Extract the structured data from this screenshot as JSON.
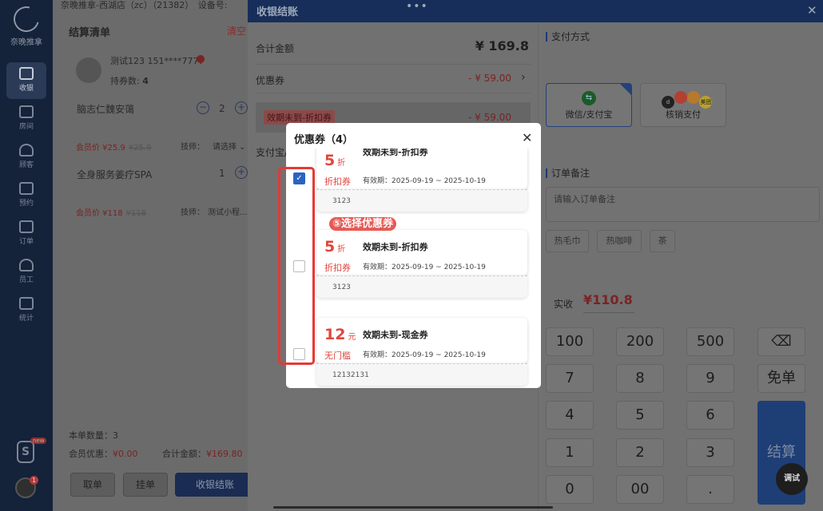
{
  "nav": {
    "brand": "奈晚推拿",
    "items": [
      {
        "label": "收银",
        "active": true
      },
      {
        "label": "房间"
      },
      {
        "label": "顾客"
      },
      {
        "label": "预约"
      },
      {
        "label": "订单"
      },
      {
        "label": "员工"
      },
      {
        "label": "统计"
      }
    ],
    "s_logo": "S",
    "new_badge": "new",
    "avatar_badge": "1"
  },
  "settlement": {
    "store_title": "奈晚推拿-西湖店（zc）（21382）　设备号:",
    "list_title": "结算清单",
    "clear_label": "清空",
    "member_name": "测试123 151****7777",
    "coupon_count_label": "持券数:",
    "coupon_count": "4",
    "items": [
      {
        "name": "脑志仁魏安蔼",
        "qty": "2",
        "member_price": "会员价 ¥25.9",
        "orig_price": "¥25.9",
        "tech_label": "技师：",
        "tech_value": "请选择 ⌄"
      },
      {
        "name": "全身服务姜疗SPA",
        "qty": "1",
        "member_price": "会员价 ¥118",
        "orig_price": "¥118",
        "tech_label": "技师：",
        "tech_value": "测试小程... ⌄"
      }
    ],
    "count_label": "本单数量：3",
    "member_discount_label": "会员优惠：",
    "member_discount": "¥0.00",
    "total_label": "合计金额：",
    "total": "¥169.80",
    "btn_cancel": "取单",
    "btn_hold": "挂单",
    "btn_checkout": "收银结账"
  },
  "cashier": {
    "title": "收银结账",
    "menu_dots": "•••",
    "close": "✕",
    "total_label": "合计金额",
    "total_value": "¥ 169.8",
    "discount_label": "优惠券",
    "discount_value": "- ¥ 59.00",
    "discount_tag": "效期未到-折扣券",
    "discount_tag_value": "- ¥ 59.00",
    "pay_method_partial": "支付宝/",
    "pay_method_title": "支付方式",
    "pay_wechat_alipay": "微信/支付宝",
    "pay_verify": "核销支付",
    "douyin_icons": [
      "d",
      "美团"
    ],
    "remark_title": "订单备注",
    "remark_placeholder": "请输入订单备注",
    "tags": [
      "热毛巾",
      "热咖啡",
      "茶"
    ],
    "paid_label": "实收",
    "paid_value": "¥110.8",
    "keypad": [
      [
        "100",
        "200",
        "500",
        "⌫"
      ],
      [
        "7",
        "8",
        "9",
        "免单"
      ],
      [
        "4",
        "5",
        "6"
      ],
      [
        "1",
        "2",
        "3"
      ],
      [
        "0",
        "00",
        "."
      ]
    ],
    "settle_label": "结算",
    "debug_label": "调试"
  },
  "coupon_modal": {
    "title": "优惠券（4）",
    "close": "✕",
    "annotation": "⑤选择优惠券",
    "coupons": [
      {
        "amount": "5",
        "unit": "折",
        "kind": "折扣券",
        "name": "效期未到-折扣券",
        "valid": "有效期：2025-09-19 ~ 2025-10-19",
        "code": "3123",
        "checked": true
      },
      {
        "amount": "5",
        "unit": "折",
        "kind": "折扣券",
        "name": "效期未到-折扣券",
        "valid": "有效期：2025-09-19 ~ 2025-10-19",
        "code": "3123",
        "checked": false
      },
      {
        "amount": "12",
        "unit": "元",
        "kind": "无门槛",
        "name": "效期未到-现金券",
        "valid": "有效期：2025-09-19 ~ 2025-10-19",
        "code": "12132131",
        "checked": false
      }
    ]
  }
}
